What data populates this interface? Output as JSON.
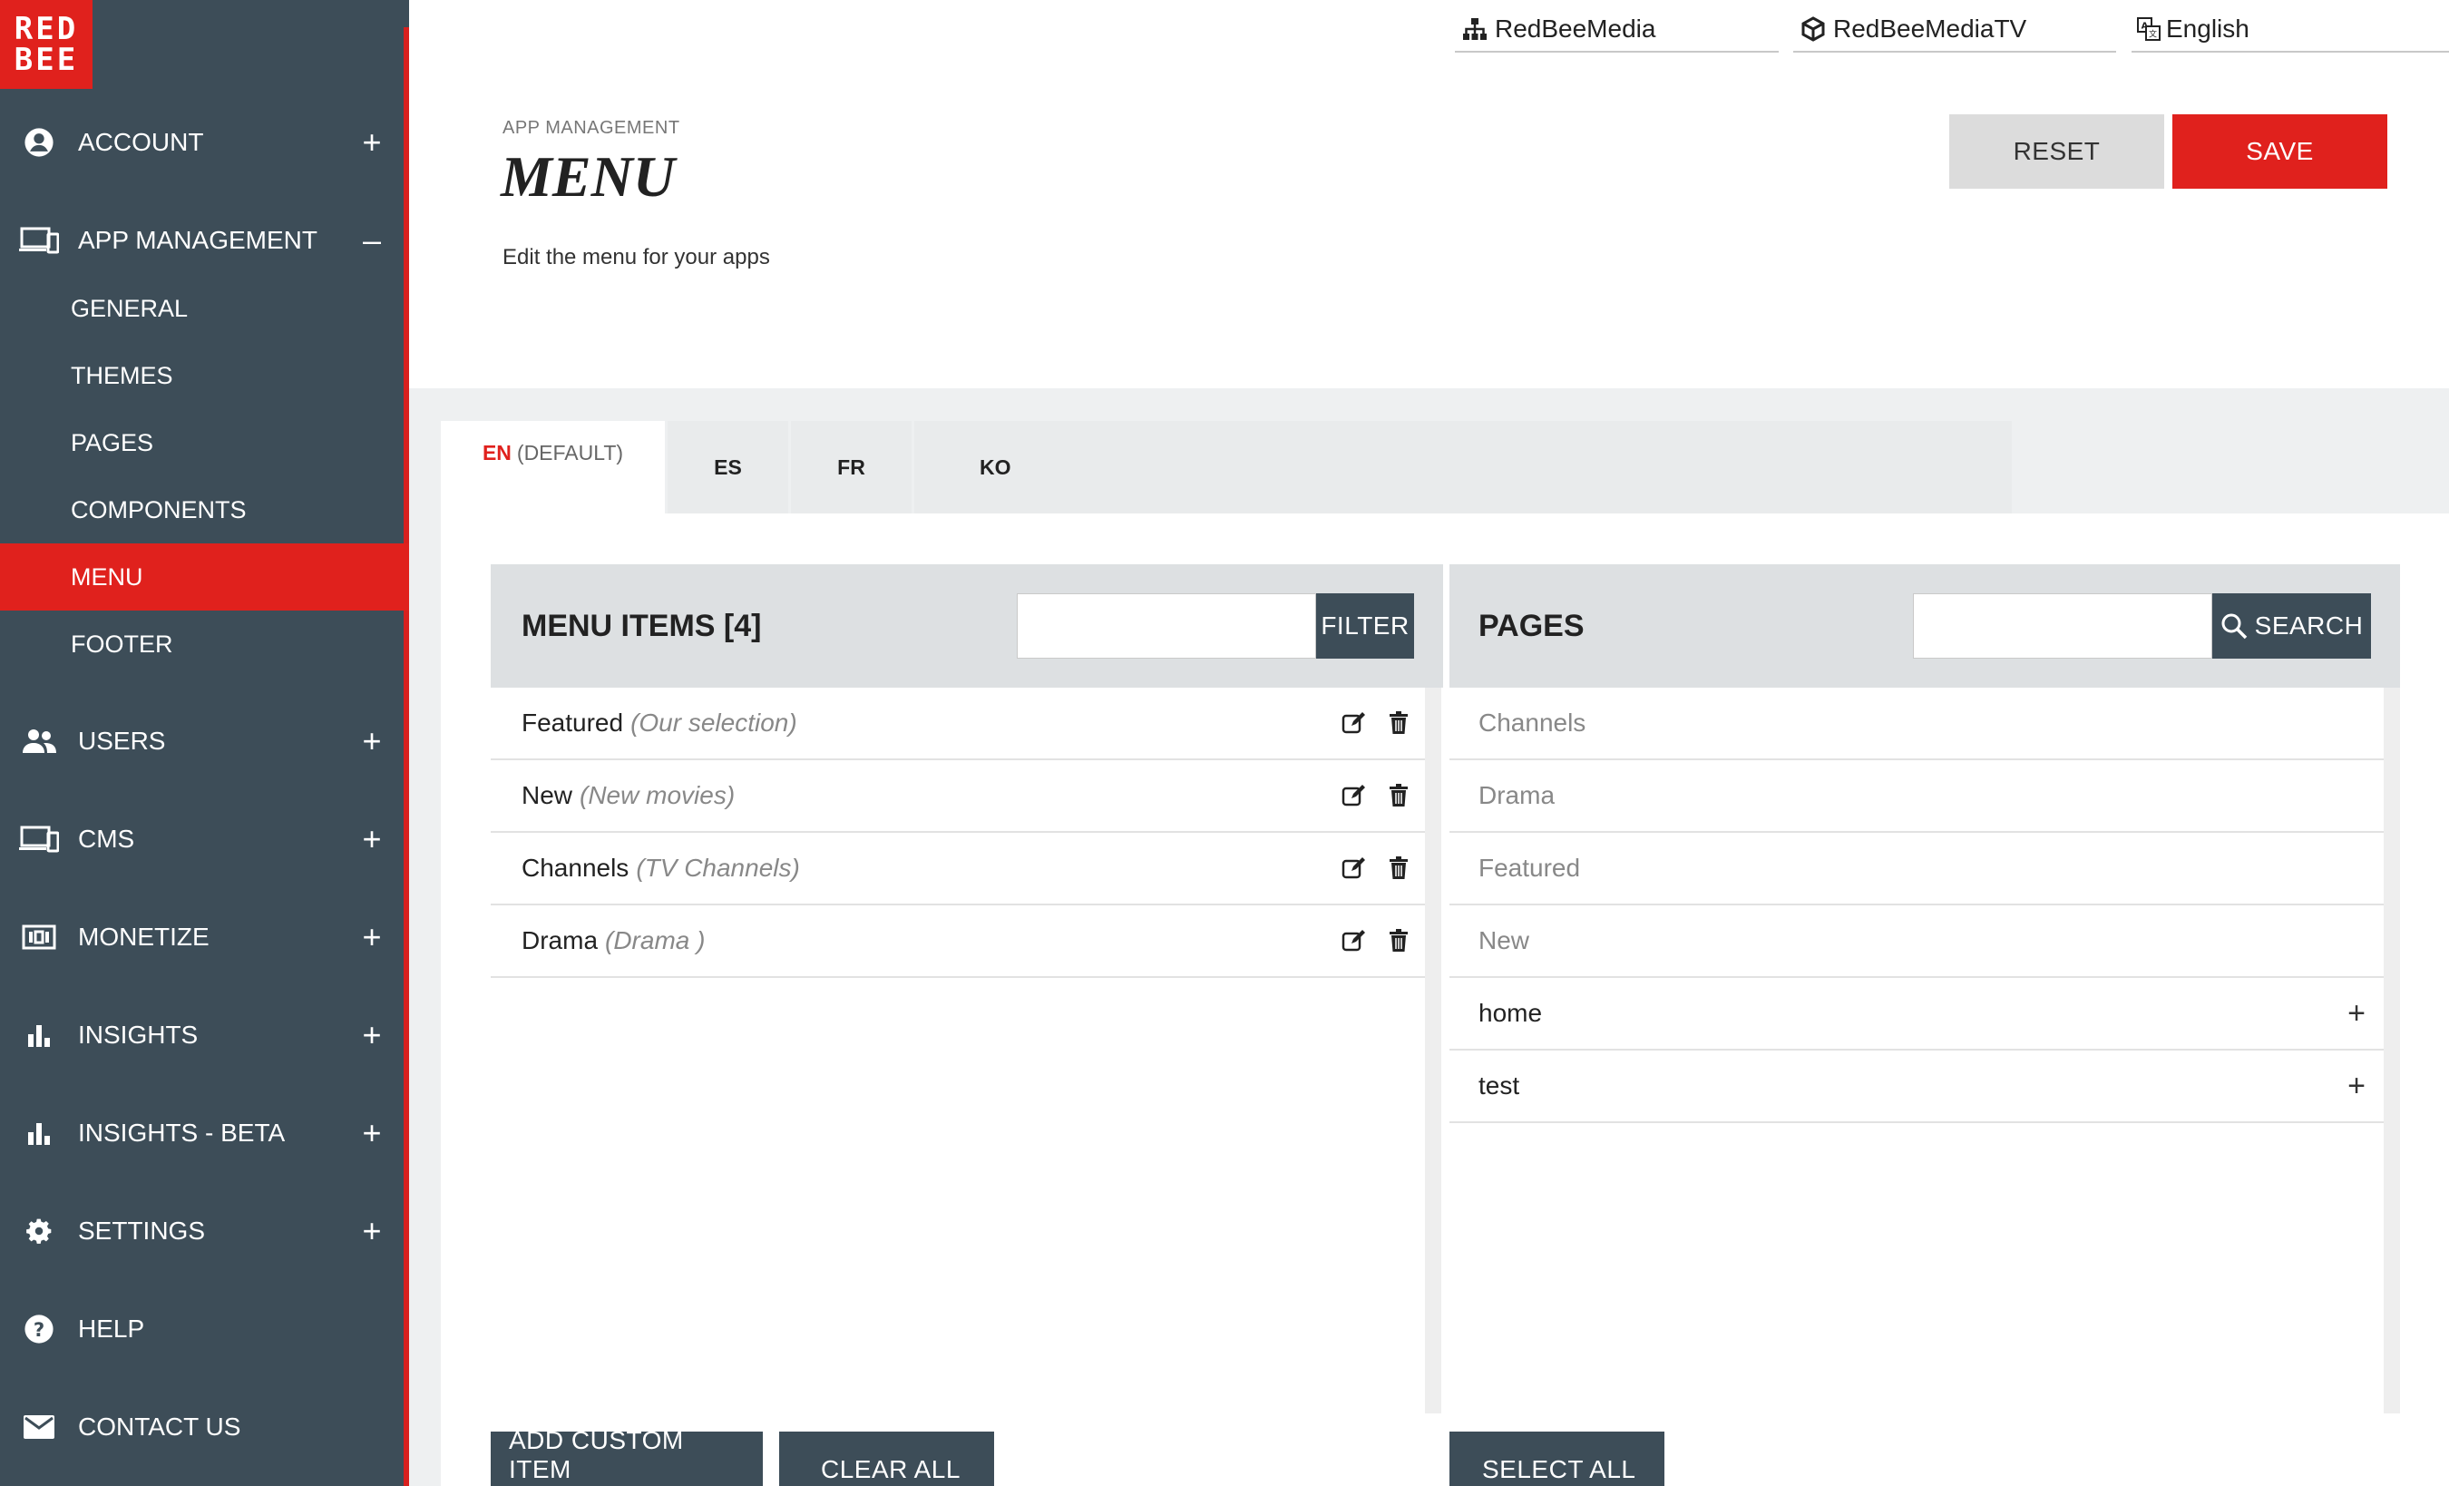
{
  "brand": {
    "logo_line1": "RED",
    "logo_line2": "BEE",
    "accent": "#e0211d",
    "sidebar_bg": "#3d4d58"
  },
  "topbar": {
    "organization": "RedBeeMedia",
    "account": "RedBeeMediaTV",
    "language": "English"
  },
  "sidebar": {
    "account": {
      "label": "ACCOUNT",
      "toggle": "+"
    },
    "app_management": {
      "label": "APP MANAGEMENT",
      "toggle": "–",
      "children": [
        "GENERAL",
        "THEMES",
        "PAGES",
        "COMPONENTS",
        "MENU",
        "FOOTER"
      ],
      "active": "MENU"
    },
    "users": {
      "label": "USERS",
      "toggle": "+"
    },
    "cms": {
      "label": "CMS",
      "toggle": "+"
    },
    "monetize": {
      "label": "MONETIZE",
      "toggle": "+"
    },
    "insights": {
      "label": "INSIGHTS",
      "toggle": "+"
    },
    "insights_beta": {
      "label": "INSIGHTS - BETA",
      "toggle": "+"
    },
    "settings": {
      "label": "SETTINGS",
      "toggle": "+"
    },
    "help": {
      "label": "HELP"
    },
    "contact": {
      "label": "CONTACT US"
    }
  },
  "header": {
    "breadcrumb": "APP MANAGEMENT",
    "title": "MENU",
    "subtitle": "Edit the menu for your apps",
    "reset_label": "RESET",
    "save_label": "SAVE"
  },
  "tabs": [
    {
      "code": "EN",
      "suffix": "(DEFAULT)",
      "active": true
    },
    {
      "code": "ES"
    },
    {
      "code": "FR"
    },
    {
      "code": "KO"
    }
  ],
  "menu_items": {
    "title": "MENU ITEMS [4]",
    "filter_value": "",
    "filter_label": "FILTER",
    "items": [
      {
        "name": "Featured",
        "desc": "(Our selection)"
      },
      {
        "name": "New",
        "desc": "(New movies)"
      },
      {
        "name": "Channels",
        "desc": "(TV Channels)"
      },
      {
        "name": "Drama",
        "desc": "(Drama )"
      }
    ],
    "add_custom_label": "ADD CUSTOM ITEM",
    "clear_all_label": "CLEAR ALL"
  },
  "pages": {
    "title": "PAGES",
    "search_value": "",
    "search_label": "SEARCH",
    "items": [
      {
        "name": "Channels",
        "added": true
      },
      {
        "name": "Drama",
        "added": true
      },
      {
        "name": "Featured",
        "added": true
      },
      {
        "name": "New",
        "added": true
      },
      {
        "name": "home",
        "added": false,
        "action": "+"
      },
      {
        "name": "test",
        "added": false,
        "action": "+"
      }
    ],
    "select_all_label": "SELECT ALL"
  }
}
